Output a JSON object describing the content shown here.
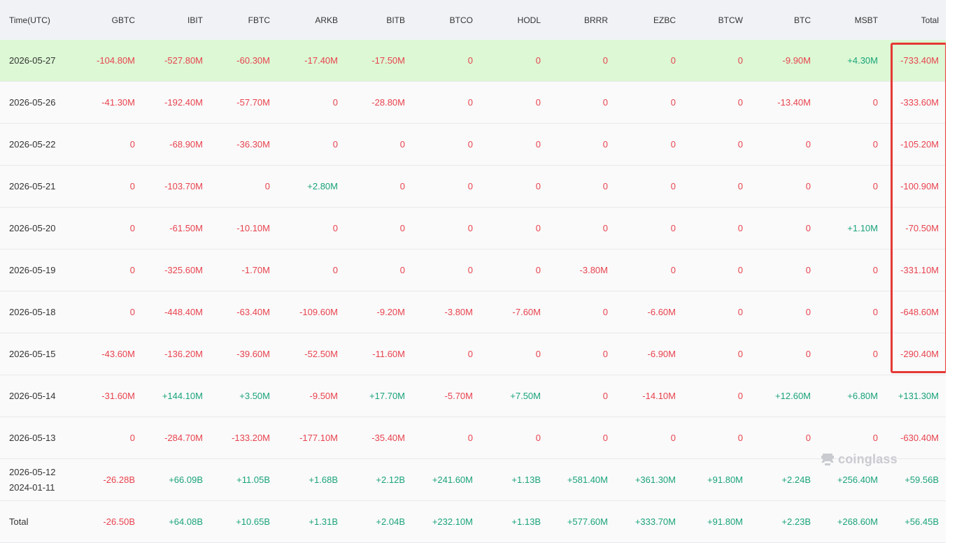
{
  "columns": [
    "Time(UTC)",
    "GBTC",
    "IBIT",
    "FBTC",
    "ARKB",
    "BITB",
    "BTCO",
    "HODL",
    "BRRR",
    "EZBC",
    "BTCW",
    "BTC",
    "MSBT",
    "Total"
  ],
  "rows": [
    {
      "date": "2026-05-27",
      "values": [
        "-104.80M",
        "-527.80M",
        "-60.30M",
        "-17.40M",
        "-17.50M",
        "0",
        "0",
        "0",
        "0",
        "0",
        "-9.90M",
        "+4.30M",
        "-733.40M"
      ]
    },
    {
      "date": "2026-05-26",
      "values": [
        "-41.30M",
        "-192.40M",
        "-57.70M",
        "0",
        "-28.80M",
        "0",
        "0",
        "0",
        "0",
        "0",
        "-13.40M",
        "0",
        "-333.60M"
      ]
    },
    {
      "date": "2026-05-22",
      "values": [
        "0",
        "-68.90M",
        "-36.30M",
        "0",
        "0",
        "0",
        "0",
        "0",
        "0",
        "0",
        "0",
        "0",
        "-105.20M"
      ]
    },
    {
      "date": "2026-05-21",
      "values": [
        "0",
        "-103.70M",
        "0",
        "+2.80M",
        "0",
        "0",
        "0",
        "0",
        "0",
        "0",
        "0",
        "0",
        "-100.90M"
      ]
    },
    {
      "date": "2026-05-20",
      "values": [
        "0",
        "-61.50M",
        "-10.10M",
        "0",
        "0",
        "0",
        "0",
        "0",
        "0",
        "0",
        "0",
        "+1.10M",
        "-70.50M"
      ]
    },
    {
      "date": "2026-05-19",
      "values": [
        "0",
        "-325.60M",
        "-1.70M",
        "0",
        "0",
        "0",
        "0",
        "-3.80M",
        "0",
        "0",
        "0",
        "0",
        "-331.10M"
      ]
    },
    {
      "date": "2026-05-18",
      "values": [
        "0",
        "-448.40M",
        "-63.40M",
        "-109.60M",
        "-9.20M",
        "-3.80M",
        "-7.60M",
        "0",
        "-6.60M",
        "0",
        "0",
        "0",
        "-648.60M"
      ]
    },
    {
      "date": "2026-05-15",
      "values": [
        "-43.60M",
        "-136.20M",
        "-39.60M",
        "-52.50M",
        "-11.60M",
        "0",
        "0",
        "0",
        "-6.90M",
        "0",
        "0",
        "0",
        "-290.40M"
      ]
    },
    {
      "date": "2026-05-14",
      "values": [
        "-31.60M",
        "+144.10M",
        "+3.50M",
        "-9.50M",
        "+17.70M",
        "-5.70M",
        "+7.50M",
        "0",
        "-14.10M",
        "0",
        "+12.60M",
        "+6.80M",
        "+131.30M"
      ]
    },
    {
      "date": "2026-05-13",
      "values": [
        "0",
        "-284.70M",
        "-133.20M",
        "-177.10M",
        "-35.40M",
        "0",
        "0",
        "0",
        "0",
        "0",
        "0",
        "0",
        "-630.40M"
      ]
    }
  ],
  "range_row": {
    "date_from": "2026-05-12",
    "date_to": "2024-01-11",
    "values": [
      "-26.28B",
      "+66.09B",
      "+11.05B",
      "+1.68B",
      "+2.12B",
      "+241.60M",
      "+1.13B",
      "+581.40M",
      "+361.30M",
      "+91.80M",
      "+2.24B",
      "+256.40M",
      "+59.56B"
    ]
  },
  "total_row": {
    "label": "Total",
    "values": [
      "-26.50B",
      "+64.08B",
      "+10.65B",
      "+1.31B",
      "+2.04B",
      "+232.10M",
      "+1.13B",
      "+577.60M",
      "+333.70M",
      "+91.80M",
      "+2.23B",
      "+268.60M",
      "+56.45B"
    ]
  },
  "watermark": "coinglass",
  "colors": {
    "negative": "#e8434e",
    "positive": "#1aa37a",
    "highlight_row": "#dcf8d4",
    "box": "#e53935"
  }
}
